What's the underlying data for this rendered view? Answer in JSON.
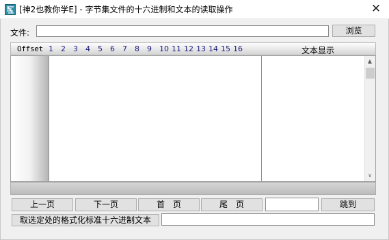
{
  "window": {
    "title": "[神2也教你学E] - 字节集文件的十六进制和文本的读取操作",
    "close_glyph": "✕"
  },
  "file": {
    "label": "文件:",
    "value": "",
    "browse_label": "浏览"
  },
  "hex_view": {
    "offset_header": "Offset",
    "columns": [
      "1",
      "2",
      "3",
      "4",
      "5",
      "6",
      "7",
      "8",
      "9",
      "10",
      "11",
      "12",
      "13",
      "14",
      "15",
      "16"
    ],
    "text_header": "文本显示",
    "rows": []
  },
  "scrollbar": {
    "up_arrow": "▲",
    "down_arrow": "∨"
  },
  "nav": {
    "prev_label": "上一页",
    "next_label": "下一页",
    "first_label": "首　页",
    "last_label": "尾　页",
    "page_value": "",
    "goto_label": "跳到"
  },
  "format": {
    "button_label": "取选定处的格式化标准十六进制文本",
    "output_value": ""
  },
  "icons": {
    "app": "app-icon",
    "close": "close-icon",
    "scroll_up": "chevron-up-icon",
    "scroll_down": "chevron-down-icon"
  },
  "colors": {
    "accent": "#1a1a80",
    "icon": "#2f8fa8"
  }
}
